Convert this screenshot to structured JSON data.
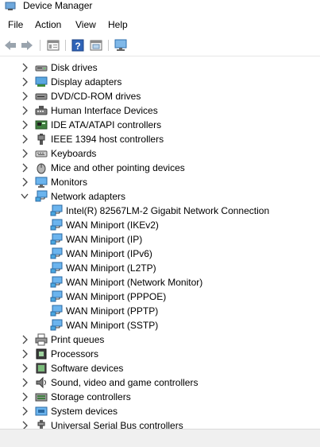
{
  "window": {
    "title": "Device Manager"
  },
  "menu": [
    {
      "label": "File"
    },
    {
      "label": "Action"
    },
    {
      "label": "View"
    },
    {
      "label": "Help"
    }
  ],
  "toolbar": {
    "buttons": [
      {
        "icon": "back-arrow-icon"
      },
      {
        "icon": "forward-arrow-icon"
      },
      {
        "icon": "properties-icon"
      },
      {
        "icon": "help-icon"
      },
      {
        "icon": "show-hidden-icon"
      },
      {
        "icon": "scan-hardware-icon"
      }
    ]
  },
  "tree": {
    "categories_top": [
      {
        "label": "Disk drives",
        "icon": "disk-drive-icon",
        "expanded": false
      },
      {
        "label": "Display adapters",
        "icon": "display-adapter-icon",
        "expanded": false
      },
      {
        "label": "DVD/CD-ROM drives",
        "icon": "dvd-drive-icon",
        "expanded": false
      },
      {
        "label": "Human Interface Devices",
        "icon": "hid-icon",
        "expanded": false
      },
      {
        "label": "IDE ATA/ATAPI controllers",
        "icon": "ide-controller-icon",
        "expanded": false
      },
      {
        "label": "IEEE 1394 host controllers",
        "icon": "ieee1394-icon",
        "expanded": false
      },
      {
        "label": "Keyboards",
        "icon": "keyboard-icon",
        "expanded": false
      },
      {
        "label": "Mice and other pointing devices",
        "icon": "mouse-icon",
        "expanded": false
      },
      {
        "label": "Monitors",
        "icon": "monitor-icon",
        "expanded": false
      }
    ],
    "network": {
      "label": "Network adapters",
      "icon": "network-adapter-icon",
      "expanded": true,
      "children": [
        {
          "label": "Intel(R) 82567LM-2 Gigabit Network Connection"
        },
        {
          "label": "WAN Miniport (IKEv2)"
        },
        {
          "label": "WAN Miniport (IP)"
        },
        {
          "label": "WAN Miniport (IPv6)"
        },
        {
          "label": "WAN Miniport (L2TP)"
        },
        {
          "label": "WAN Miniport (Network Monitor)"
        },
        {
          "label": "WAN Miniport (PPPOE)"
        },
        {
          "label": "WAN Miniport (PPTP)"
        },
        {
          "label": "WAN Miniport (SSTP)"
        }
      ]
    },
    "categories_bottom": [
      {
        "label": "Print queues",
        "icon": "printer-icon",
        "expanded": false
      },
      {
        "label": "Processors",
        "icon": "processor-icon",
        "expanded": false
      },
      {
        "label": "Software devices",
        "icon": "software-device-icon",
        "expanded": false
      },
      {
        "label": "Sound, video and game controllers",
        "icon": "sound-icon",
        "expanded": false
      },
      {
        "label": "Storage controllers",
        "icon": "storage-controller-icon",
        "expanded": false
      },
      {
        "label": "System devices",
        "icon": "system-device-icon",
        "expanded": false
      },
      {
        "label": "Universal Serial Bus controllers",
        "icon": "usb-icon",
        "expanded": false
      }
    ]
  }
}
